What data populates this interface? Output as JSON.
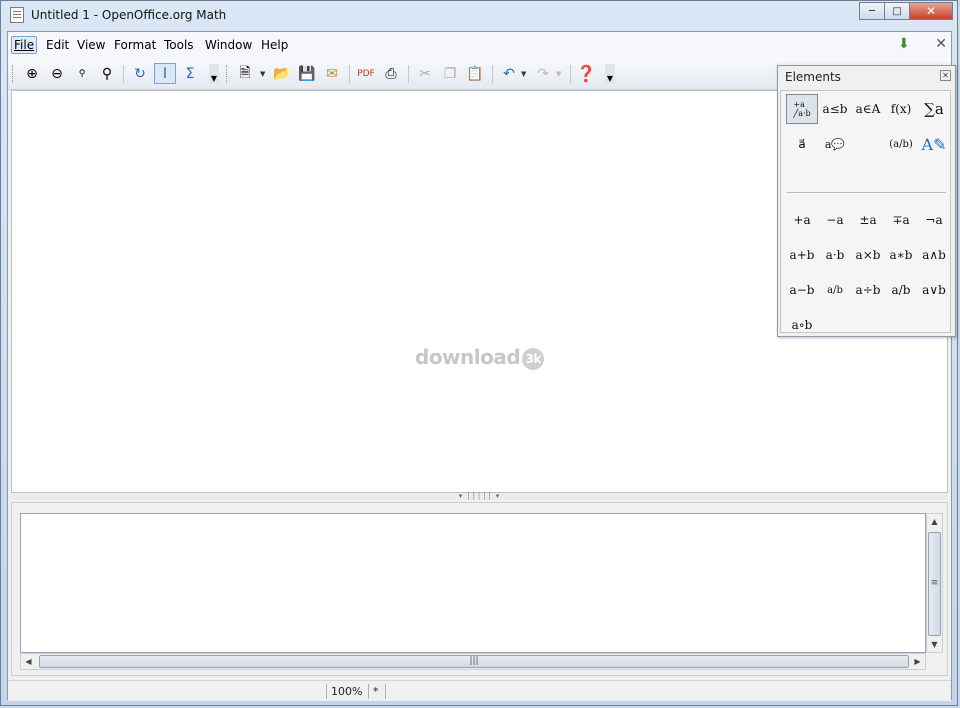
{
  "window": {
    "title": "Untitled 1 - OpenOffice.org Math"
  },
  "menubar": {
    "items": [
      {
        "label": "File",
        "active": true
      },
      {
        "label": "Edit"
      },
      {
        "label": "View"
      },
      {
        "label": "Format"
      },
      {
        "label": "Tools"
      },
      {
        "label": "Window"
      },
      {
        "label": "Help"
      }
    ]
  },
  "toolbar": {
    "icons": [
      "zoom-in-icon",
      "zoom-out-icon",
      "zoom-100-icon",
      "zoom-icon",
      "update-icon",
      "formula-cursor-icon",
      "elements-icon",
      "new-icon",
      "open-icon",
      "save-icon",
      "email-icon",
      "export-pdf-icon",
      "print-icon",
      "cut-icon",
      "copy-icon",
      "paste-icon",
      "undo-icon",
      "redo-icon",
      "help-icon"
    ]
  },
  "watermark": {
    "text": "download",
    "badge": "3k"
  },
  "statusbar": {
    "zoom": "100%",
    "modified": "*"
  },
  "elements": {
    "title": "Elements",
    "categories": [
      "a≤b",
      "a∈A",
      "f(x)",
      "∑a",
      "a⃗",
      "(a/b)"
    ],
    "operators": [
      "+a",
      "−a",
      "±a",
      "∓a",
      "¬a",
      "a+b",
      "a·b",
      "a×b",
      "a∗b",
      "a∧b",
      "a−b",
      "a/b",
      "a÷b",
      "a/b",
      "a∨b",
      "a∘b"
    ]
  }
}
